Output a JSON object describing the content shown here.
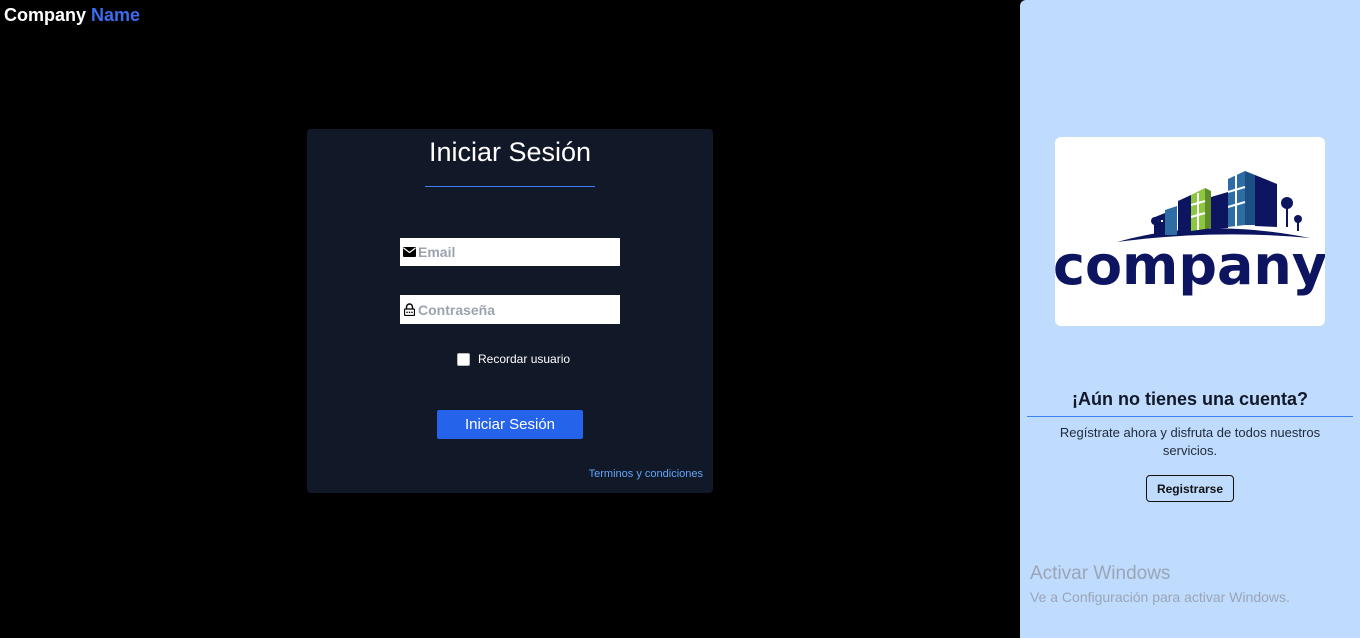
{
  "brand": {
    "part1": "Company",
    "part2": "Name"
  },
  "login": {
    "title": "Iniciar Sesión",
    "email_placeholder": "Email",
    "password_placeholder": "Contraseña",
    "remember_label": "Recordar usuario",
    "remember_checked": false,
    "submit_label": "Iniciar Sesión",
    "terms_label": "Terminos y condiciones"
  },
  "side": {
    "logo_text": "company",
    "question": "¡Aún no tienes una cuenta?",
    "description": "Regístrate ahora y disfruta de todos nuestros servicios.",
    "register_label": "Registrarse"
  },
  "watermark": {
    "title": "Activar Windows",
    "subtitle": "Ve a Configuración para activar Windows."
  },
  "colors": {
    "background": "#000000",
    "card": "#111827",
    "accent": "#2563eb",
    "panel": "#bfdbfe",
    "logo_navy": "#0d1560",
    "logo_green": "#8dc63f",
    "logo_blue": "#2e6da4"
  },
  "icons": {
    "email": "envelope-icon",
    "password": "lock-icon",
    "logo": "company-building-logo"
  }
}
